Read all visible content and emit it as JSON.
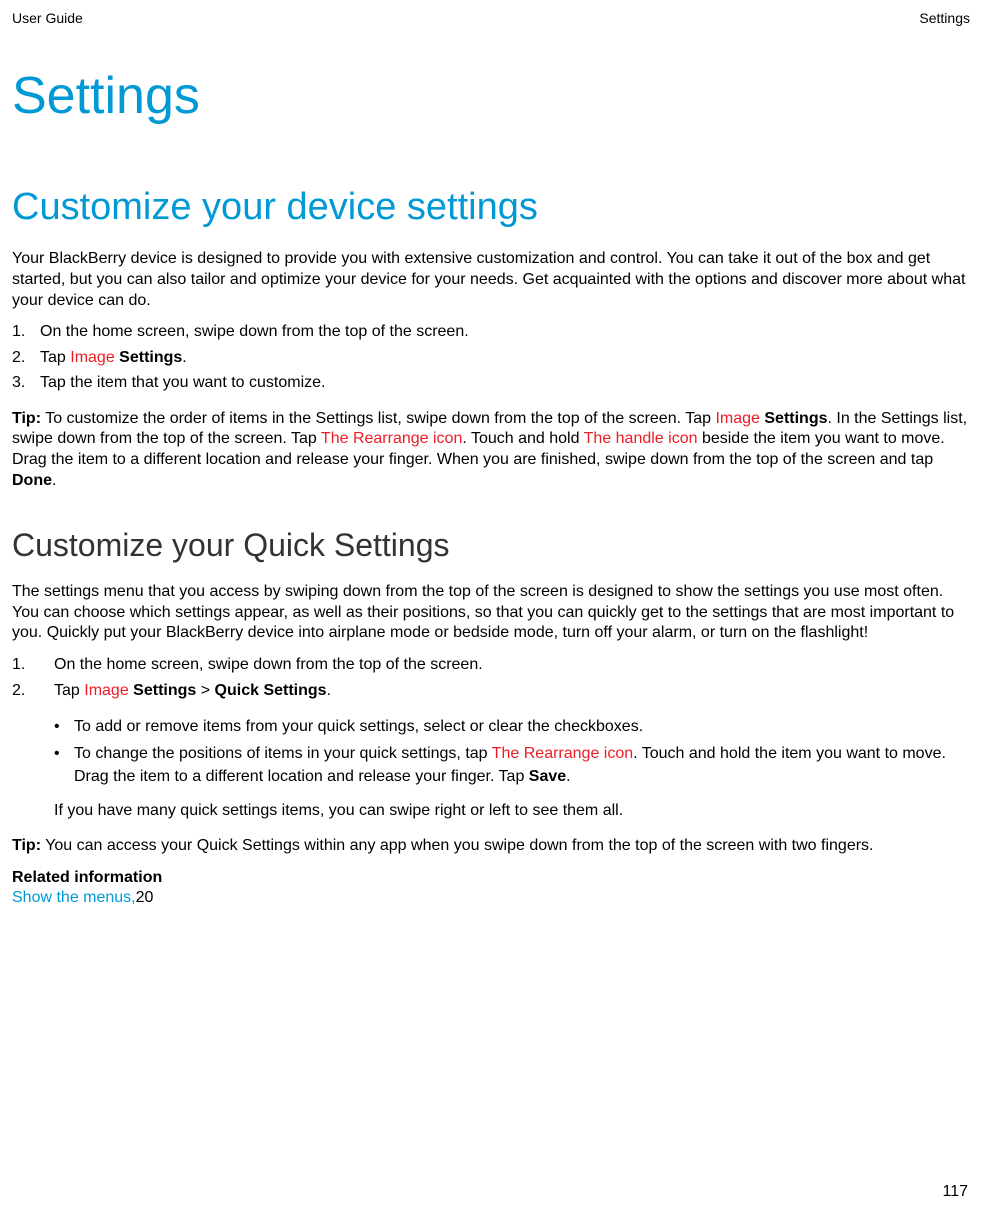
{
  "header": {
    "left": "User Guide",
    "right": "Settings"
  },
  "title": "Settings",
  "section1": {
    "heading": "Customize your device settings",
    "intro": "Your BlackBerry device is designed to provide you with extensive customization and control. You can take it out of the box and get started, but you can also tailor and optimize your device for your needs. Get acquainted with the options and discover more about what your device can do.",
    "steps": {
      "s1": "On the home screen, swipe down from the top of the screen.",
      "s2_pre": "Tap ",
      "s2_image": "Image",
      "s2_settings": "Settings",
      "s2_post": ".",
      "s3": "Tap the item that you want to customize."
    },
    "tip": {
      "label": "Tip:",
      "t1": " To customize the order of items in the Settings list, swipe down from the top of the screen. Tap ",
      "image": "Image",
      "settings": "Settings",
      "t2": ". In the Settings list, swipe down from the top of the screen. Tap ",
      "rearrange": "The Rearrange icon",
      "t3": ". Touch and hold ",
      "handle": "The handle icon",
      "t4": " beside the item you want to move. Drag the item to a different location and release your finger. When you are finished, swipe down from the top of the screen and tap ",
      "done": "Done",
      "t5": "."
    }
  },
  "section2": {
    "heading": "Customize your Quick Settings",
    "intro": "The settings menu that you access by swiping down from the top of the screen is designed to show the settings you use most often. You can choose which settings appear, as well as their positions, so that you can quickly get to the settings that are most important to you. Quickly put your BlackBerry device into airplane mode or bedside mode, turn off your alarm, or turn on the flashlight!",
    "steps": {
      "s1": "On the home screen, swipe down from the top of the screen.",
      "s2_pre": "Tap ",
      "s2_image": "Image",
      "s2_settings": "Settings",
      "s2_mid": " > ",
      "s2_quick": "Quick Settings",
      "s2_post": "."
    },
    "bullets": {
      "b1": "To add or remove items from your quick settings, select or clear the checkboxes.",
      "b2_pre": "To change the positions of items in your quick settings, tap ",
      "b2_rearrange": "The Rearrange icon",
      "b2_mid": ". Touch and hold the item you want to move. Drag the item to a different location and release your finger. Tap ",
      "b2_save": "Save",
      "b2_post": "."
    },
    "note": "If you have many quick settings items, you can swipe right or left to see them all.",
    "tip": {
      "label": "Tip:",
      "text": " You can access your Quick Settings within any app when you swipe down from the top of the screen with two fingers."
    },
    "related": {
      "heading": "Related information",
      "link": "Show the menus,",
      "page": "20"
    }
  },
  "page_number": "117"
}
